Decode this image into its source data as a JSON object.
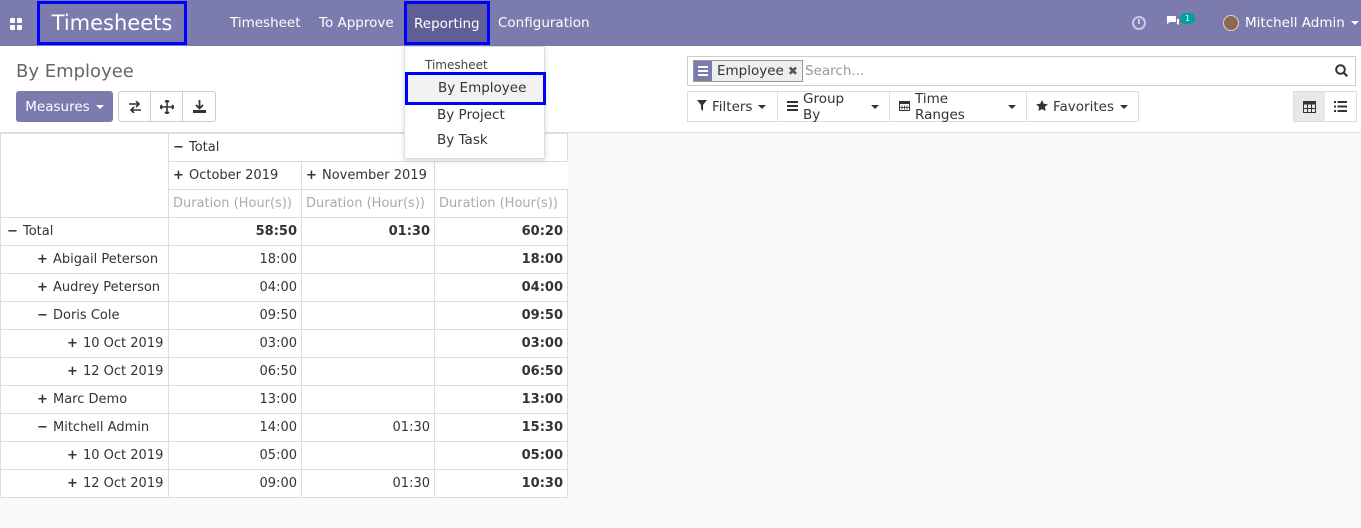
{
  "navbar": {
    "brand": "Timesheets",
    "menu": [
      "Timesheet",
      "To Approve",
      "Reporting",
      "Configuration"
    ],
    "notifications_count": "1",
    "user_name": "Mitchell Admin"
  },
  "reporting_menu": {
    "section_header": "Timesheet",
    "items": [
      "By Employee",
      "By Project",
      "By Task"
    ]
  },
  "control_panel": {
    "title": "By Employee",
    "measures_label": "Measures",
    "search": {
      "facet_label": "Employee",
      "placeholder": "Search..."
    },
    "filters_label": "Filters",
    "group_by_label": "Group By",
    "time_ranges_label": "Time Ranges",
    "favorites_label": "Favorites"
  },
  "pivot": {
    "col_total": "Total",
    "col_groups": [
      "October 2019",
      "November 2019"
    ],
    "measure": "Duration (Hour(s))",
    "rows": [
      {
        "label": "Total",
        "sign": "−",
        "oct": "58:50",
        "nov": "01:30",
        "total": "60:20",
        "level": 0,
        "bold": true
      },
      {
        "label": "Abigail Peterson",
        "sign": "+",
        "oct": "18:00",
        "nov": "",
        "total": "18:00",
        "level": 1
      },
      {
        "label": "Audrey Peterson",
        "sign": "+",
        "oct": "04:00",
        "nov": "",
        "total": "04:00",
        "level": 1
      },
      {
        "label": "Doris Cole",
        "sign": "−",
        "oct": "09:50",
        "nov": "",
        "total": "09:50",
        "level": 1
      },
      {
        "label": "10 Oct 2019",
        "sign": "+",
        "oct": "03:00",
        "nov": "",
        "total": "03:00",
        "level": 2
      },
      {
        "label": "12 Oct 2019",
        "sign": "+",
        "oct": "06:50",
        "nov": "",
        "total": "06:50",
        "level": 2
      },
      {
        "label": "Marc Demo",
        "sign": "+",
        "oct": "13:00",
        "nov": "",
        "total": "13:00",
        "level": 1
      },
      {
        "label": "Mitchell Admin",
        "sign": "−",
        "oct": "14:00",
        "nov": "01:30",
        "total": "15:30",
        "level": 1
      },
      {
        "label": "10 Oct 2019",
        "sign": "+",
        "oct": "05:00",
        "nov": "",
        "total": "05:00",
        "level": 2
      },
      {
        "label": "12 Oct 2019",
        "sign": "+",
        "oct": "09:00",
        "nov": "01:30",
        "total": "10:30",
        "level": 2
      }
    ]
  }
}
